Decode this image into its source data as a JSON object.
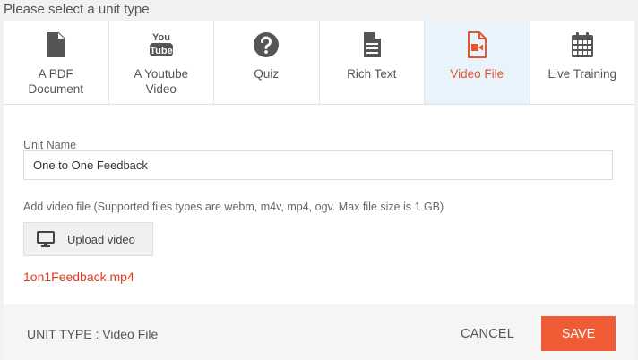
{
  "heading": "Please select a unit type",
  "tabs": [
    {
      "label": "A PDF\nDocument",
      "icon": "pdf-document-icon"
    },
    {
      "label": "A Youtube\nVideo",
      "icon": "youtube-icon"
    },
    {
      "label": "Quiz",
      "icon": "question-circle-icon"
    },
    {
      "label": "Rich Text",
      "icon": "text-file-icon"
    },
    {
      "label": "Video File",
      "icon": "video-file-icon",
      "active": true
    },
    {
      "label": "Live Training",
      "icon": "calendar-icon"
    }
  ],
  "youtube_logo": {
    "line1": "You",
    "line2": "Tube"
  },
  "form": {
    "unit_name_label": "Unit Name",
    "unit_name_value": "One to One Feedback",
    "upload_hint": "Add video file (Supported files types are webm, m4v, mp4, ogv. Max file size is 1 GB)",
    "upload_button": "Upload video",
    "file_name": "1on1Feedback.mp4"
  },
  "footer": {
    "unit_type": "UNIT TYPE : Video File",
    "cancel": "CANCEL",
    "save": "SAVE"
  },
  "colors": {
    "accent": "#ef5b35",
    "active_tab_bg": "#e8f3fb",
    "icon": "#555555",
    "file_name": "#e03a1e"
  }
}
